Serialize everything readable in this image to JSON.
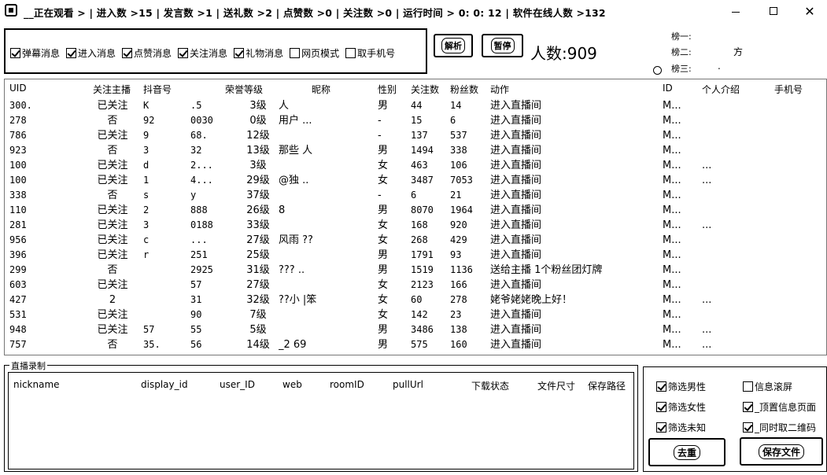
{
  "window": {
    "title": "__正在观看 > | 进入数 >15 | 发言数 >1 | 送礼数 >2 | 点赞数 >0 | 关注数 >0 | 运行时间 >  0: 0: 12 | 软件在线人数 >132",
    "minimize_icon": "minimize-icon",
    "maximize_icon": "maximize-icon",
    "close_icon": "close-icon"
  },
  "controls": {
    "checkboxes": [
      {
        "label": "弹幕消息",
        "checked": true
      },
      {
        "label": "进入消息",
        "checked": true
      },
      {
        "label": "点赞消息",
        "checked": true
      },
      {
        "label": "关注消息",
        "checked": true
      },
      {
        "label": "礼物消息",
        "checked": true
      },
      {
        "label": "网页模式",
        "checked": false
      },
      {
        "label": "取手机号",
        "checked": false
      }
    ],
    "parse_button": "解析",
    "pause_button": "暂停",
    "people_count": "人数:909",
    "ranks": [
      {
        "label": "榜一:",
        "value": ""
      },
      {
        "label": "榜二:",
        "value": "方"
      },
      {
        "label": "榜三:",
        "value": "."
      }
    ]
  },
  "table": {
    "headers": [
      "UID",
      "关注主播",
      "抖音号",
      "荣誉等级",
      "昵称",
      "性别",
      "关注数",
      "粉丝数",
      "动作",
      "ID",
      "个人介绍",
      "手机号"
    ],
    "rows": [
      [
        "300.",
        "已关注",
        "K",
        ".5",
        "3级",
        "人",
        "男",
        "44",
        "14",
        "进入直播间",
        "M...",
        "",
        ""
      ],
      [
        "278",
        "否",
        "92",
        "0030",
        "0级",
        "用户  ...",
        "-",
        "15",
        "6",
        "进入直播间",
        "M...",
        "",
        ""
      ],
      [
        "786",
        "已关注",
        "9",
        "68.",
        "12级",
        "",
        "-",
        "137",
        "537",
        "进入直播间",
        "M...",
        "",
        ""
      ],
      [
        "923",
        "否",
        "3",
        "32",
        "13级",
        "那些          人",
        "男",
        "1494",
        "338",
        "进入直播间",
        "M...",
        "",
        ""
      ],
      [
        "100",
        "已关注",
        "d",
        "2...",
        "3级",
        "",
        "女",
        "463",
        "106",
        "进入直播间",
        "M...",
        "...",
        ""
      ],
      [
        "100",
        "已关注",
        "1",
        "4...",
        "29级",
        "@独          ..",
        "女",
        "3487",
        "7053",
        "进入直播间",
        "M...",
        "...",
        ""
      ],
      [
        "338",
        "否",
        "s",
        "y",
        "37级",
        "",
        "-",
        "6",
        "21",
        "进入直播间",
        "M...",
        "",
        ""
      ],
      [
        "110",
        "已关注",
        "2",
        "888",
        "26级",
        "8",
        "男",
        "8070",
        "1964",
        "进入直播间",
        "M...",
        "",
        ""
      ],
      [
        "281",
        "已关注",
        "3",
        "0188",
        "33级",
        "",
        "女",
        "168",
        "920",
        "进入直播间",
        "M...",
        "...",
        ""
      ],
      [
        "956",
        "已关注",
        "c",
        "...",
        "27级",
        "风雨        ??",
        "女",
        "268",
        "429",
        "进入直播间",
        "M...",
        "",
        ""
      ],
      [
        "396",
        "已关注",
        "r",
        "251",
        "25级",
        "",
        "男",
        "1791",
        "93",
        "进入直播间",
        "M...",
        "",
        ""
      ],
      [
        "299",
        "否",
        "",
        "2925",
        "31级",
        "???         ..",
        "男",
        "1519",
        "1136",
        "送给主播 1个粉丝团灯牌",
        "M...",
        "",
        ""
      ],
      [
        "603",
        "已关注",
        "",
        "57",
        "27级",
        "",
        "女",
        "2123",
        "166",
        "进入直播间",
        "M...",
        "",
        ""
      ],
      [
        "427",
        "2",
        "",
        "31",
        "32级",
        "??小        |笨",
        "女",
        "60",
        "278",
        "姥爷姥姥晚上好！",
        "M...",
        "...",
        ""
      ],
      [
        "531",
        "已关注",
        "",
        "90",
        "7级",
        "",
        "女",
        "142",
        "23",
        "进入直播间",
        "M...",
        "",
        ""
      ],
      [
        "948",
        "已关注",
        "57",
        "55",
        "5级",
        "",
        "男",
        "3486",
        "138",
        "进入直播间",
        "M...",
        "...",
        ""
      ],
      [
        "757",
        "否",
        "35.",
        "56",
        "14级",
        "_2        69",
        "男",
        "575",
        "160",
        "进入直播间",
        "M...",
        "...",
        ""
      ]
    ]
  },
  "record": {
    "title": "直播录制",
    "columns": [
      "nickname",
      "display_id",
      "user_ID",
      "web",
      "roomID",
      "pullUrl",
      "下载状态",
      "文件尺寸",
      "保存路径"
    ]
  },
  "filters": {
    "left": [
      {
        "label": "筛选男性",
        "checked": true
      },
      {
        "label": "筛选女性",
        "checked": true
      },
      {
        "label": "筛选未知",
        "checked": true
      }
    ],
    "right": [
      {
        "label": "信息滚屏",
        "checked": false
      },
      {
        "label": "_顶置信息页面",
        "checked": true
      },
      {
        "label": "_同时取二维码",
        "checked": true
      }
    ],
    "clear_button": "去重",
    "save_button": "保存文件"
  }
}
